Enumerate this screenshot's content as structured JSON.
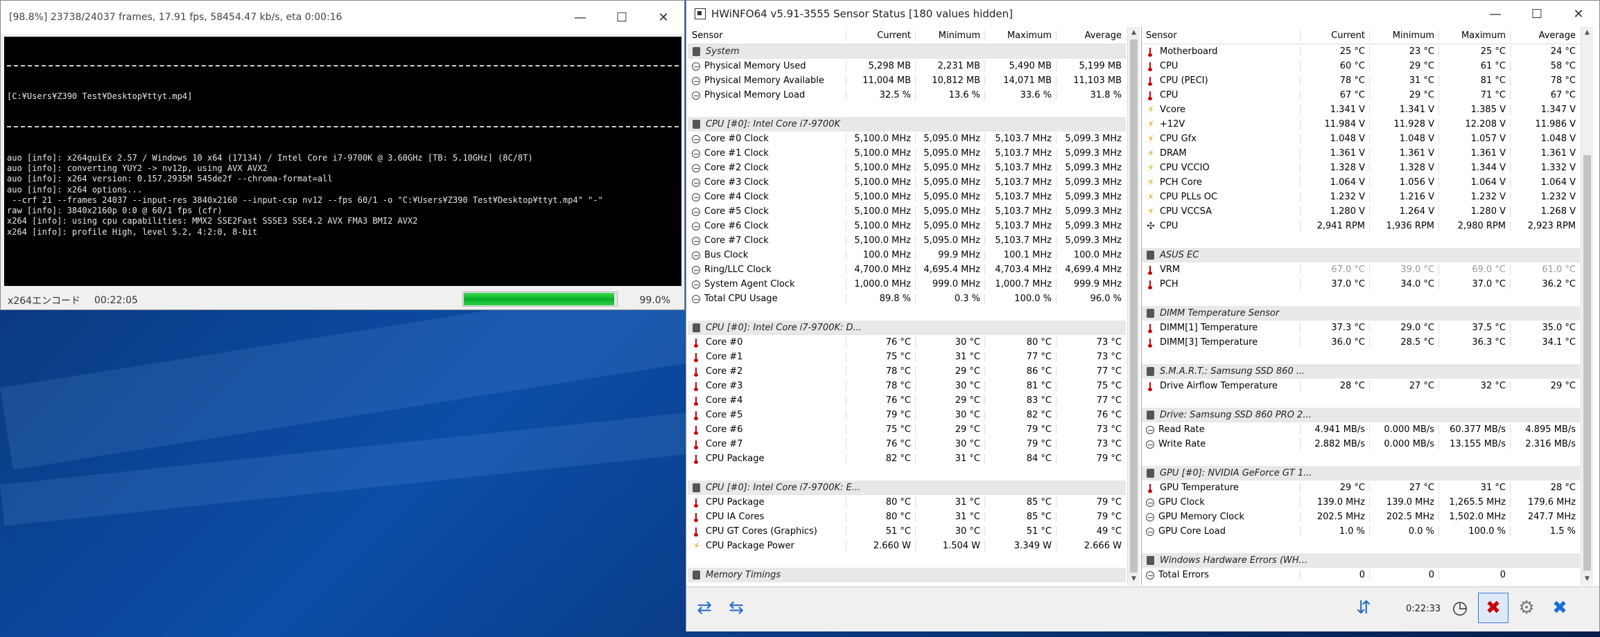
{
  "encoder": {
    "title": "[98.8%] 23738/24037 frames, 17.91 fps, 58454.47 kb/s, eta 0:00:16",
    "command_path": "[C:¥Users¥Z390 Test¥Desktop¥ttyt.mp4]",
    "log_lines": [
      "auo [info]: x264guiEx 2.57 / Windows 10 x64 (17134) / Intel Core i7-9700K @ 3.60GHz [TB: 5.10GHz] (8C/8T)",
      "auo [info]: converting YUY2 -> nv12p, using AVX AVX2",
      "auo [info]: x264 version: 0.157.2935M 545de2f --chroma-format=all",
      "auo [info]: x264 options...",
      " --crf 21 --frames 24037 --input-res 3840x2160 --input-csp nv12 --fps 60/1 -o \"C:¥Users¥Z390 Test¥Desktop¥ttyt.mp4\" \"-\"",
      "raw [info]: 3840x2160p 0:0 @ 60/1 fps (cfr)",
      "x264 [info]: using cpu capabilities: MMX2 SSE2Fast SSSE3 SSE4.2 AVX FMA3 BMI2 AVX2",
      "x264 [info]: profile High, level 5.2, 4:2:0, 8-bit"
    ],
    "status_label": "x264エンコード",
    "elapsed": "00:22:05",
    "progress_fraction": 0.988,
    "progress_text": "99.0%"
  },
  "hwinfo": {
    "title": "HWiNFO64 v5.91-3555 Sensor Status [180 values hidden]",
    "timer": "0:22:33",
    "columns": [
      "Sensor",
      "Current",
      "Minimum",
      "Maximum",
      "Average"
    ],
    "left_rows": [
      {
        "type": "group",
        "name": "System"
      },
      {
        "icon": "gauge",
        "name": "Physical Memory Used",
        "cur": "5,298 MB",
        "min": "2,231 MB",
        "max": "5,490 MB",
        "avg": "5,199 MB"
      },
      {
        "icon": "gauge",
        "name": "Physical Memory Available",
        "cur": "11,004 MB",
        "min": "10,812 MB",
        "max": "14,071 MB",
        "avg": "11,103 MB"
      },
      {
        "icon": "gauge",
        "name": "Physical Memory Load",
        "cur": "32.5 %",
        "min": "13.6 %",
        "max": "33.6 %",
        "avg": "31.8 %"
      },
      {
        "type": "blank"
      },
      {
        "type": "group",
        "name": "CPU [#0]: Intel Core i7-9700K"
      },
      {
        "icon": "gauge",
        "name": "Core #0 Clock",
        "cur": "5,100.0 MHz",
        "min": "5,095.0 MHz",
        "max": "5,103.7 MHz",
        "avg": "5,099.3 MHz"
      },
      {
        "icon": "gauge",
        "name": "Core #1 Clock",
        "cur": "5,100.0 MHz",
        "min": "5,095.0 MHz",
        "max": "5,103.7 MHz",
        "avg": "5,099.3 MHz"
      },
      {
        "icon": "gauge",
        "name": "Core #2 Clock",
        "cur": "5,100.0 MHz",
        "min": "5,095.0 MHz",
        "max": "5,103.7 MHz",
        "avg": "5,099.3 MHz"
      },
      {
        "icon": "gauge",
        "name": "Core #3 Clock",
        "cur": "5,100.0 MHz",
        "min": "5,095.0 MHz",
        "max": "5,103.7 MHz",
        "avg": "5,099.3 MHz"
      },
      {
        "icon": "gauge",
        "name": "Core #4 Clock",
        "cur": "5,100.0 MHz",
        "min": "5,095.0 MHz",
        "max": "5,103.7 MHz",
        "avg": "5,099.3 MHz"
      },
      {
        "icon": "gauge",
        "name": "Core #5 Clock",
        "cur": "5,100.0 MHz",
        "min": "5,095.0 MHz",
        "max": "5,103.7 MHz",
        "avg": "5,099.3 MHz"
      },
      {
        "icon": "gauge",
        "name": "Core #6 Clock",
        "cur": "5,100.0 MHz",
        "min": "5,095.0 MHz",
        "max": "5,103.7 MHz",
        "avg": "5,099.3 MHz"
      },
      {
        "icon": "gauge",
        "name": "Core #7 Clock",
        "cur": "5,100.0 MHz",
        "min": "5,095.0 MHz",
        "max": "5,103.7 MHz",
        "avg": "5,099.3 MHz"
      },
      {
        "icon": "gauge",
        "name": "Bus Clock",
        "cur": "100.0 MHz",
        "min": "99.9 MHz",
        "max": "100.1 MHz",
        "avg": "100.0 MHz"
      },
      {
        "icon": "gauge",
        "name": "Ring/LLC Clock",
        "cur": "4,700.0 MHz",
        "min": "4,695.4 MHz",
        "max": "4,703.4 MHz",
        "avg": "4,699.4 MHz"
      },
      {
        "icon": "gauge",
        "name": "System Agent Clock",
        "cur": "1,000.0 MHz",
        "min": "999.0 MHz",
        "max": "1,000.7 MHz",
        "avg": "999.9 MHz"
      },
      {
        "icon": "gauge",
        "name": "Total CPU Usage",
        "cur": "89.8 %",
        "min": "0.3 %",
        "max": "100.0 %",
        "avg": "96.0 %"
      },
      {
        "type": "blank"
      },
      {
        "type": "group",
        "name": "CPU [#0]: Intel Core i7-9700K: D..."
      },
      {
        "icon": "therm",
        "name": "Core #0",
        "cur": "76 °C",
        "min": "30 °C",
        "max": "80 °C",
        "avg": "73 °C"
      },
      {
        "icon": "therm",
        "name": "Core #1",
        "cur": "75 °C",
        "min": "31 °C",
        "max": "77 °C",
        "avg": "73 °C"
      },
      {
        "icon": "therm",
        "name": "Core #2",
        "cur": "78 °C",
        "min": "29 °C",
        "max": "86 °C",
        "avg": "77 °C"
      },
      {
        "icon": "therm",
        "name": "Core #3",
        "cur": "78 °C",
        "min": "30 °C",
        "max": "81 °C",
        "avg": "75 °C"
      },
      {
        "icon": "therm",
        "name": "Core #4",
        "cur": "76 °C",
        "min": "29 °C",
        "max": "83 °C",
        "avg": "77 °C"
      },
      {
        "icon": "therm",
        "name": "Core #5",
        "cur": "79 °C",
        "min": "30 °C",
        "max": "82 °C",
        "avg": "76 °C"
      },
      {
        "icon": "therm",
        "name": "Core #6",
        "cur": "75 °C",
        "min": "29 °C",
        "max": "79 °C",
        "avg": "73 °C"
      },
      {
        "icon": "therm",
        "name": "Core #7",
        "cur": "76 °C",
        "min": "30 °C",
        "max": "79 °C",
        "avg": "73 °C"
      },
      {
        "icon": "therm",
        "name": "CPU Package",
        "cur": "82 °C",
        "min": "31 °C",
        "max": "84 °C",
        "avg": "79 °C"
      },
      {
        "type": "blank"
      },
      {
        "type": "group",
        "name": "CPU [#0]: Intel Core i7-9700K: E..."
      },
      {
        "icon": "therm",
        "name": "CPU Package",
        "cur": "80 °C",
        "min": "31 °C",
        "max": "85 °C",
        "avg": "79 °C"
      },
      {
        "icon": "therm",
        "name": "CPU IA Cores",
        "cur": "80 °C",
        "min": "31 °C",
        "max": "85 °C",
        "avg": "79 °C"
      },
      {
        "icon": "therm",
        "name": "CPU GT Cores (Graphics)",
        "cur": "51 °C",
        "min": "30 °C",
        "max": "51 °C",
        "avg": "49 °C"
      },
      {
        "icon": "bolt",
        "name": "CPU Package Power",
        "cur": "2.660 W",
        "min": "1.504 W",
        "max": "3.349 W",
        "avg": "2.666 W"
      },
      {
        "type": "blank"
      },
      {
        "type": "group",
        "name": "Memory Timings"
      }
    ],
    "right_rows": [
      {
        "icon": "therm",
        "name": "Motherboard",
        "cur": "25 °C",
        "min": "23 °C",
        "max": "25 °C",
        "avg": "24 °C"
      },
      {
        "icon": "therm",
        "name": "CPU",
        "cur": "60 °C",
        "min": "29 °C",
        "max": "61 °C",
        "avg": "58 °C"
      },
      {
        "icon": "therm",
        "name": "CPU (PECI)",
        "cur": "78 °C",
        "min": "31 °C",
        "max": "81 °C",
        "avg": "78 °C"
      },
      {
        "icon": "therm",
        "name": "CPU",
        "cur": "67 °C",
        "min": "29 °C",
        "max": "71 °C",
        "avg": "67 °C"
      },
      {
        "icon": "bolt",
        "name": "Vcore",
        "cur": "1.341 V",
        "min": "1.341 V",
        "max": "1.385 V",
        "avg": "1.347 V"
      },
      {
        "icon": "bolt",
        "name": "+12V",
        "cur": "11.984 V",
        "min": "11.928 V",
        "max": "12.208 V",
        "avg": "11.986 V"
      },
      {
        "icon": "bolt",
        "name": "CPU Gfx",
        "cur": "1.048 V",
        "min": "1.048 V",
        "max": "1.057 V",
        "avg": "1.048 V"
      },
      {
        "icon": "bolt",
        "name": "DRAM",
        "cur": "1.361 V",
        "min": "1.361 V",
        "max": "1.361 V",
        "avg": "1.361 V"
      },
      {
        "icon": "bolt",
        "name": "CPU VCCIO",
        "cur": "1.328 V",
        "min": "1.328 V",
        "max": "1.344 V",
        "avg": "1.332 V"
      },
      {
        "icon": "bolt",
        "name": "PCH Core",
        "cur": "1.064 V",
        "min": "1.056 V",
        "max": "1.064 V",
        "avg": "1.064 V"
      },
      {
        "icon": "bolt",
        "name": "CPU PLLs OC",
        "cur": "1.232 V",
        "min": "1.216 V",
        "max": "1.232 V",
        "avg": "1.232 V"
      },
      {
        "icon": "bolt",
        "name": "CPU VCCSA",
        "cur": "1.280 V",
        "min": "1.264 V",
        "max": "1.280 V",
        "avg": "1.268 V"
      },
      {
        "icon": "fan",
        "name": "CPU",
        "cur": "2,941 RPM",
        "min": "1,936 RPM",
        "max": "2,980 RPM",
        "avg": "2,923 RPM"
      },
      {
        "type": "blank"
      },
      {
        "type": "group",
        "name": "ASUS EC"
      },
      {
        "icon": "therm",
        "name": "VRM",
        "cur": "67.0 °C",
        "min": "39.0 °C",
        "max": "69.0 °C",
        "avg": "61.0 °C",
        "dim": true
      },
      {
        "icon": "therm",
        "name": "PCH",
        "cur": "37.0 °C",
        "min": "34.0 °C",
        "max": "37.0 °C",
        "avg": "36.2 °C"
      },
      {
        "type": "blank"
      },
      {
        "type": "group",
        "name": "DIMM Temperature Sensor"
      },
      {
        "icon": "therm",
        "name": "DIMM[1] Temperature",
        "cur": "37.3 °C",
        "min": "29.0 °C",
        "max": "37.5 °C",
        "avg": "35.0 °C"
      },
      {
        "icon": "therm",
        "name": "DIMM[3] Temperature",
        "cur": "36.0 °C",
        "min": "28.5 °C",
        "max": "36.3 °C",
        "avg": "34.1 °C"
      },
      {
        "type": "blank"
      },
      {
        "type": "group",
        "name": "S.M.A.R.T.: Samsung SSD 860 ..."
      },
      {
        "icon": "therm",
        "name": "Drive Airflow Temperature",
        "cur": "28 °C",
        "min": "27 °C",
        "max": "32 °C",
        "avg": "29 °C"
      },
      {
        "type": "blank"
      },
      {
        "type": "group",
        "name": "Drive: Samsung SSD 860 PRO 2..."
      },
      {
        "icon": "gauge",
        "name": "Read Rate",
        "cur": "4.941 MB/s",
        "min": "0.000 MB/s",
        "max": "60.377 MB/s",
        "avg": "4.895 MB/s"
      },
      {
        "icon": "gauge",
        "name": "Write Rate",
        "cur": "2.882 MB/s",
        "min": "0.000 MB/s",
        "max": "13.155 MB/s",
        "avg": "2.316 MB/s"
      },
      {
        "type": "blank"
      },
      {
        "type": "group",
        "name": "GPU [#0]: NVIDIA GeForce GT 1..."
      },
      {
        "icon": "therm",
        "name": "GPU Temperature",
        "cur": "29 °C",
        "min": "27 °C",
        "max": "31 °C",
        "avg": "28 °C"
      },
      {
        "icon": "gauge",
        "name": "GPU Clock",
        "cur": "139.0 MHz",
        "min": "139.0 MHz",
        "max": "1,265.5 MHz",
        "avg": "179.6 MHz"
      },
      {
        "icon": "gauge",
        "name": "GPU Memory Clock",
        "cur": "202.5 MHz",
        "min": "202.5 MHz",
        "max": "1,502.0 MHz",
        "avg": "247.7 MHz"
      },
      {
        "icon": "gauge",
        "name": "GPU Core Load",
        "cur": "1.0 %",
        "min": "0.0 %",
        "max": "100.0 %",
        "avg": "1.5 %"
      },
      {
        "type": "blank"
      },
      {
        "type": "group",
        "name": "Windows Hardware Errors (WH..."
      },
      {
        "icon": "gauge",
        "name": "Total Errors",
        "cur": "0",
        "min": "0",
        "max": "0",
        "avg": ""
      }
    ]
  }
}
